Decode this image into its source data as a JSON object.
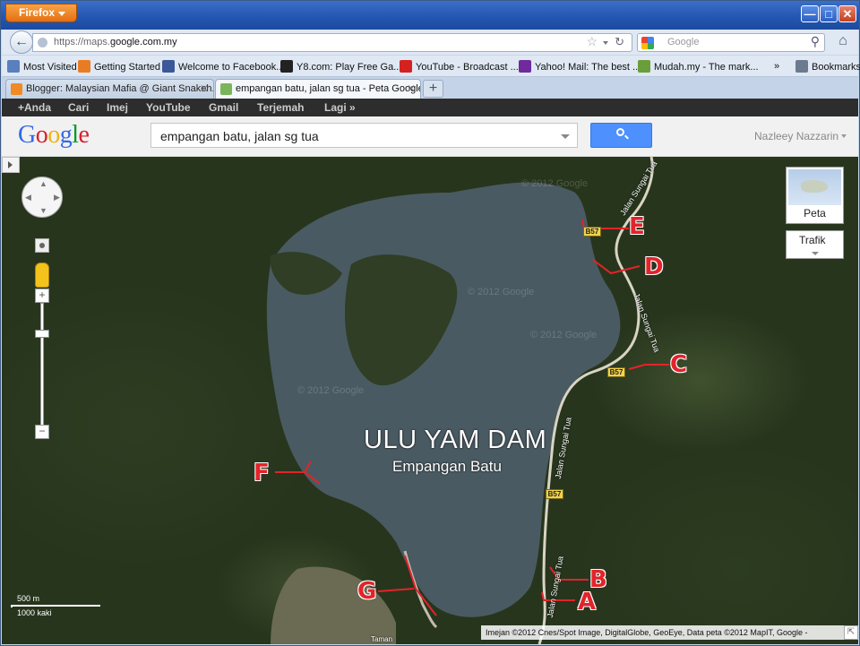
{
  "browser": {
    "menu_label": "Firefox",
    "window_controls": {
      "minimize": "—",
      "maximize": "□",
      "close": "✕"
    },
    "url_prefix": "https://maps.",
    "url_domain": "google.com.my",
    "search_placeholder": "Google",
    "bookmarks": [
      {
        "label": "Most Visited",
        "icon": "most-visited-icon",
        "color": "#5a7fbd"
      },
      {
        "label": "Getting Started",
        "icon": "firefox-icon",
        "color": "#e97c22"
      },
      {
        "label": "Welcome to Facebook...",
        "icon": "facebook-icon",
        "color": "#3b5998"
      },
      {
        "label": "Y8.com: Play Free Ga...",
        "icon": "y8-icon",
        "color": "#222222"
      },
      {
        "label": "YouTube - Broadcast ...",
        "icon": "youtube-icon",
        "color": "#d62121"
      },
      {
        "label": "Yahoo! Mail: The best ...",
        "icon": "yahoo-icon",
        "color": "#6f2b9c"
      },
      {
        "label": "Mudah.my - The mark...",
        "icon": "mudah-icon",
        "color": "#6a9e3a"
      }
    ],
    "bookmarks_overflow": "»",
    "bookmarks_menu": "Bookmarks",
    "tabs": [
      {
        "label": "Blogger: Malaysian Mafia @ Giant Snakeh...",
        "icon": "blogger-icon",
        "color": "#f08a24",
        "active": false
      },
      {
        "label": "empangan batu, jalan sg tua - Peta Google",
        "icon": "google-maps-icon",
        "color": "#7ab55c",
        "active": true
      }
    ],
    "new_tab": "+"
  },
  "google_bar": [
    "+Anda",
    "Cari",
    "Imej",
    "YouTube",
    "Gmail",
    "Terjemah",
    "Lagi »"
  ],
  "header": {
    "logo": [
      "G",
      "o",
      "o",
      "g",
      "l",
      "e"
    ],
    "logo_colors": [
      "#3369e8",
      "#d5212e",
      "#eeb211",
      "#3369e8",
      "#009925",
      "#d5212e"
    ],
    "search_value": "empangan batu, jalan sg tua",
    "user_name": "Nazleey Nazzarin"
  },
  "map": {
    "title": "ULU YAM DAM",
    "subtitle": "Empangan Batu",
    "markers": [
      "A",
      "B",
      "C",
      "D",
      "E",
      "F",
      "G"
    ],
    "road_labels": [
      "Jalan Sungai Tua",
      "Jalan Sungai Tua",
      "Jalan Sungai Tua",
      "Jalan Sungai Tua"
    ],
    "road_shields": [
      "B57",
      "B57",
      "B57"
    ],
    "watermarks": [
      "© 2012 Google",
      "© 2012 Google",
      "© 2012 Google",
      "© 2012 Google"
    ],
    "map_type": "Peta",
    "traffic": "Trafik",
    "scale_metric": "500 m",
    "scale_imperial": "1000 kaki",
    "copyright": "Imejan ©2012 Cnes/Spot Image, DigitalGlobe, GeoEye, Data peta ©2012 MapIT, Google -",
    "place_label": "Taman",
    "marker_color": "#e3232a",
    "water_color": "#4a5a62"
  }
}
